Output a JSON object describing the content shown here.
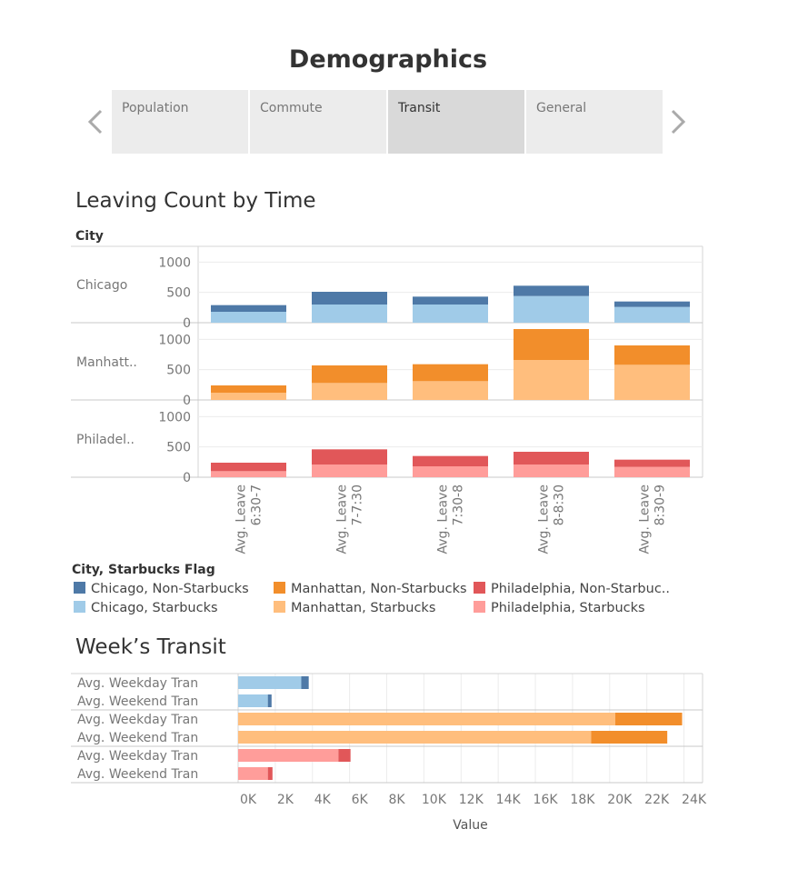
{
  "dashboard": {
    "title": "Demographics",
    "tabs": [
      {
        "label": "Population",
        "selected": false
      },
      {
        "label": "Commute",
        "selected": false
      },
      {
        "label": "Transit",
        "selected": true
      },
      {
        "label": "General",
        "selected": false
      }
    ]
  },
  "colors": {
    "Chicago, Non-Starbucks": "#4e79a7",
    "Chicago, Starbucks": "#a0cbe8",
    "Manhattan, Non-Starbucks": "#f28e2b",
    "Manhattan, Starbucks": "#ffbe7d",
    "Philadelphia, Non-Starbucks": "#e15759",
    "Philadelphia, Starbucks": "#ff9d9a"
  },
  "legend": {
    "title": "City, Starbucks Flag",
    "items": [
      {
        "label": "Chicago, Non-Starbucks",
        "key": "Chicago, Non-Starbucks"
      },
      {
        "label": "Manhattan, Non-Starbucks",
        "key": "Manhattan, Non-Starbucks"
      },
      {
        "label": "Philadelphia, Non-Starbuc..",
        "key": "Philadelphia, Non-Starbucks"
      },
      {
        "label": "Chicago, Starbucks",
        "key": "Chicago, Starbucks"
      },
      {
        "label": "Manhattan, Starbucks",
        "key": "Manhattan, Starbucks"
      },
      {
        "label": "Philadelphia, Starbucks",
        "key": "Philadelphia, Starbucks"
      }
    ]
  },
  "chart_data": [
    {
      "type": "bar",
      "stacked": true,
      "title": "Leaving Count by Time",
      "row_header": "City",
      "categories": [
        "Avg. Leave 6:30-7",
        "Avg. Leave 7-7:30",
        "Avg. Leave 7:30-8",
        "Avg. Leave 8-8:30",
        "Avg. Leave 8:30-9"
      ],
      "category_lines": [
        [
          "Avg. Leave",
          "6:30-7"
        ],
        [
          "Avg. Leave",
          "7-7:30"
        ],
        [
          "Avg. Leave",
          "7:30-8"
        ],
        [
          "Avg. Leave",
          "8-8:30"
        ],
        [
          "Avg. Leave",
          "8:30-9"
        ]
      ],
      "ylim": [
        0,
        1200
      ],
      "yticks": [
        0,
        500,
        1000
      ],
      "ytick_labels": [
        "0",
        "500",
        "1000"
      ],
      "panels": [
        {
          "label": "Chicago",
          "series": [
            {
              "name": "Chicago, Starbucks",
              "values": [
                180,
                300,
                300,
                440,
                260
              ]
            },
            {
              "name": "Chicago, Non-Starbucks",
              "values": [
                110,
                210,
                130,
                170,
                90
              ]
            }
          ]
        },
        {
          "label": "Manhatt..",
          "series": [
            {
              "name": "Manhattan, Starbucks",
              "values": [
                120,
                280,
                310,
                660,
                580
              ]
            },
            {
              "name": "Manhattan, Non-Starbucks",
              "values": [
                120,
                290,
                280,
                510,
                320
              ]
            }
          ]
        },
        {
          "label": "Philadel..",
          "series": [
            {
              "name": "Philadelphia, Starbucks",
              "values": [
                100,
                210,
                180,
                210,
                170
              ]
            },
            {
              "name": "Philadelphia, Non-Starbucks",
              "values": [
                140,
                250,
                170,
                210,
                120
              ]
            }
          ]
        }
      ]
    },
    {
      "type": "bar",
      "orientation": "horizontal",
      "stacked": true,
      "title": "Week’s Transit",
      "xlabel": "Value",
      "xlim": [
        0,
        25000
      ],
      "xticks": [
        0,
        2000,
        4000,
        6000,
        8000,
        10000,
        12000,
        14000,
        16000,
        18000,
        20000,
        22000,
        24000
      ],
      "xtick_labels": [
        "0K",
        "2K",
        "4K",
        "6K",
        "8K",
        "10K",
        "12K",
        "14K",
        "16K",
        "18K",
        "20K",
        "22K",
        "24K"
      ],
      "groups": [
        {
          "city": "Chicago",
          "rows": [
            {
              "label": "Avg. Weekday Tran",
              "starbucks": 3400,
              "non_starbucks": 400
            },
            {
              "label": "Avg. Weekend Tran",
              "starbucks": 1600,
              "non_starbucks": 200
            }
          ]
        },
        {
          "city": "Manhattan",
          "rows": [
            {
              "label": "Avg. Weekday Tran",
              "starbucks": 20300,
              "non_starbucks": 3600
            },
            {
              "label": "Avg. Weekend Tran",
              "starbucks": 19000,
              "non_starbucks": 4100
            }
          ]
        },
        {
          "city": "Philadelphia",
          "rows": [
            {
              "label": "Avg. Weekday Tran",
              "starbucks": 5400,
              "non_starbucks": 650
            },
            {
              "label": "Avg. Weekend Tran",
              "starbucks": 1600,
              "non_starbucks": 250
            }
          ]
        }
      ]
    }
  ]
}
